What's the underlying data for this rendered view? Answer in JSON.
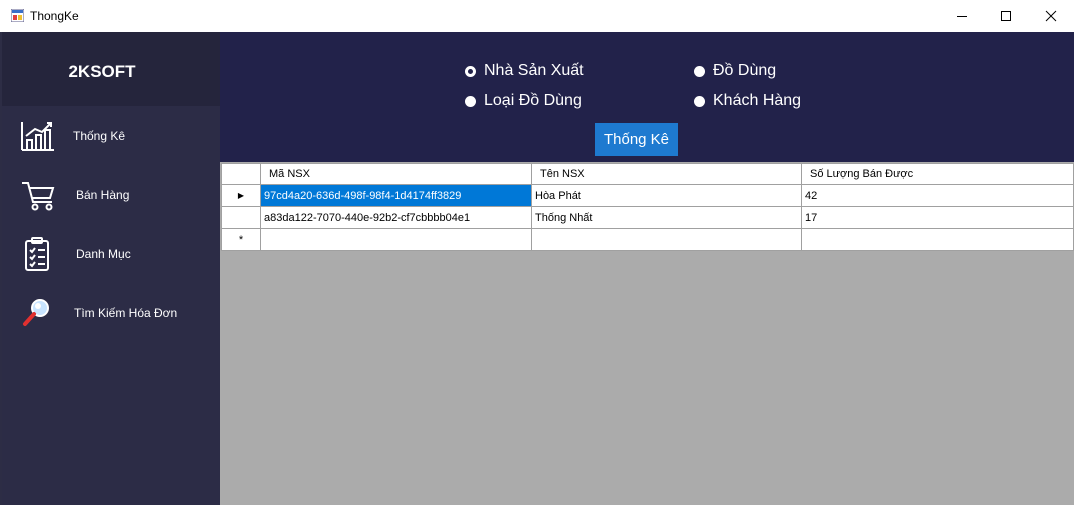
{
  "window": {
    "title": "ThongKe",
    "minimize_icon": "minimize-icon",
    "maximize_icon": "maximize-icon",
    "close_icon": "close-icon"
  },
  "sidebar": {
    "logo": "2KSOFT",
    "items": [
      {
        "label": "Thống Kê",
        "icon": "bar-chart-icon"
      },
      {
        "label": "Bán Hàng",
        "icon": "shopping-cart-icon"
      },
      {
        "label": "Danh Mục",
        "icon": "clipboard-checklist-icon"
      },
      {
        "label": "Tìm Kiếm Hóa Đơn",
        "icon": "magnifier-icon"
      }
    ]
  },
  "header": {
    "radios": [
      {
        "label": "Nhà Sản Xuất",
        "checked": true
      },
      {
        "label": "Đồ Dùng",
        "checked": false
      },
      {
        "label": "Loại Đồ Dùng",
        "checked": false
      },
      {
        "label": "Khách Hàng",
        "checked": false
      }
    ],
    "action_button": "Thống Kê"
  },
  "grid": {
    "columns": [
      "Mã NSX",
      "Tên NSX",
      "Số Lượng Bán Được"
    ],
    "rows": [
      [
        "97cd4a20-636d-498f-98f4-1d4174ff3829",
        "Hòa Phát",
        "42"
      ],
      [
        "a83da122-7070-440e-92b2-cf7cbbbb04e1",
        "Thống Nhất",
        "17"
      ]
    ],
    "current_row_marker": "▶",
    "new_row_marker": "*"
  },
  "colors": {
    "sidebar_bg": "#2c2c46",
    "header_bg": "#22224a",
    "accent_button": "#1e7ad0",
    "selection": "#0078d7",
    "grid_empty_bg": "#ababab"
  }
}
